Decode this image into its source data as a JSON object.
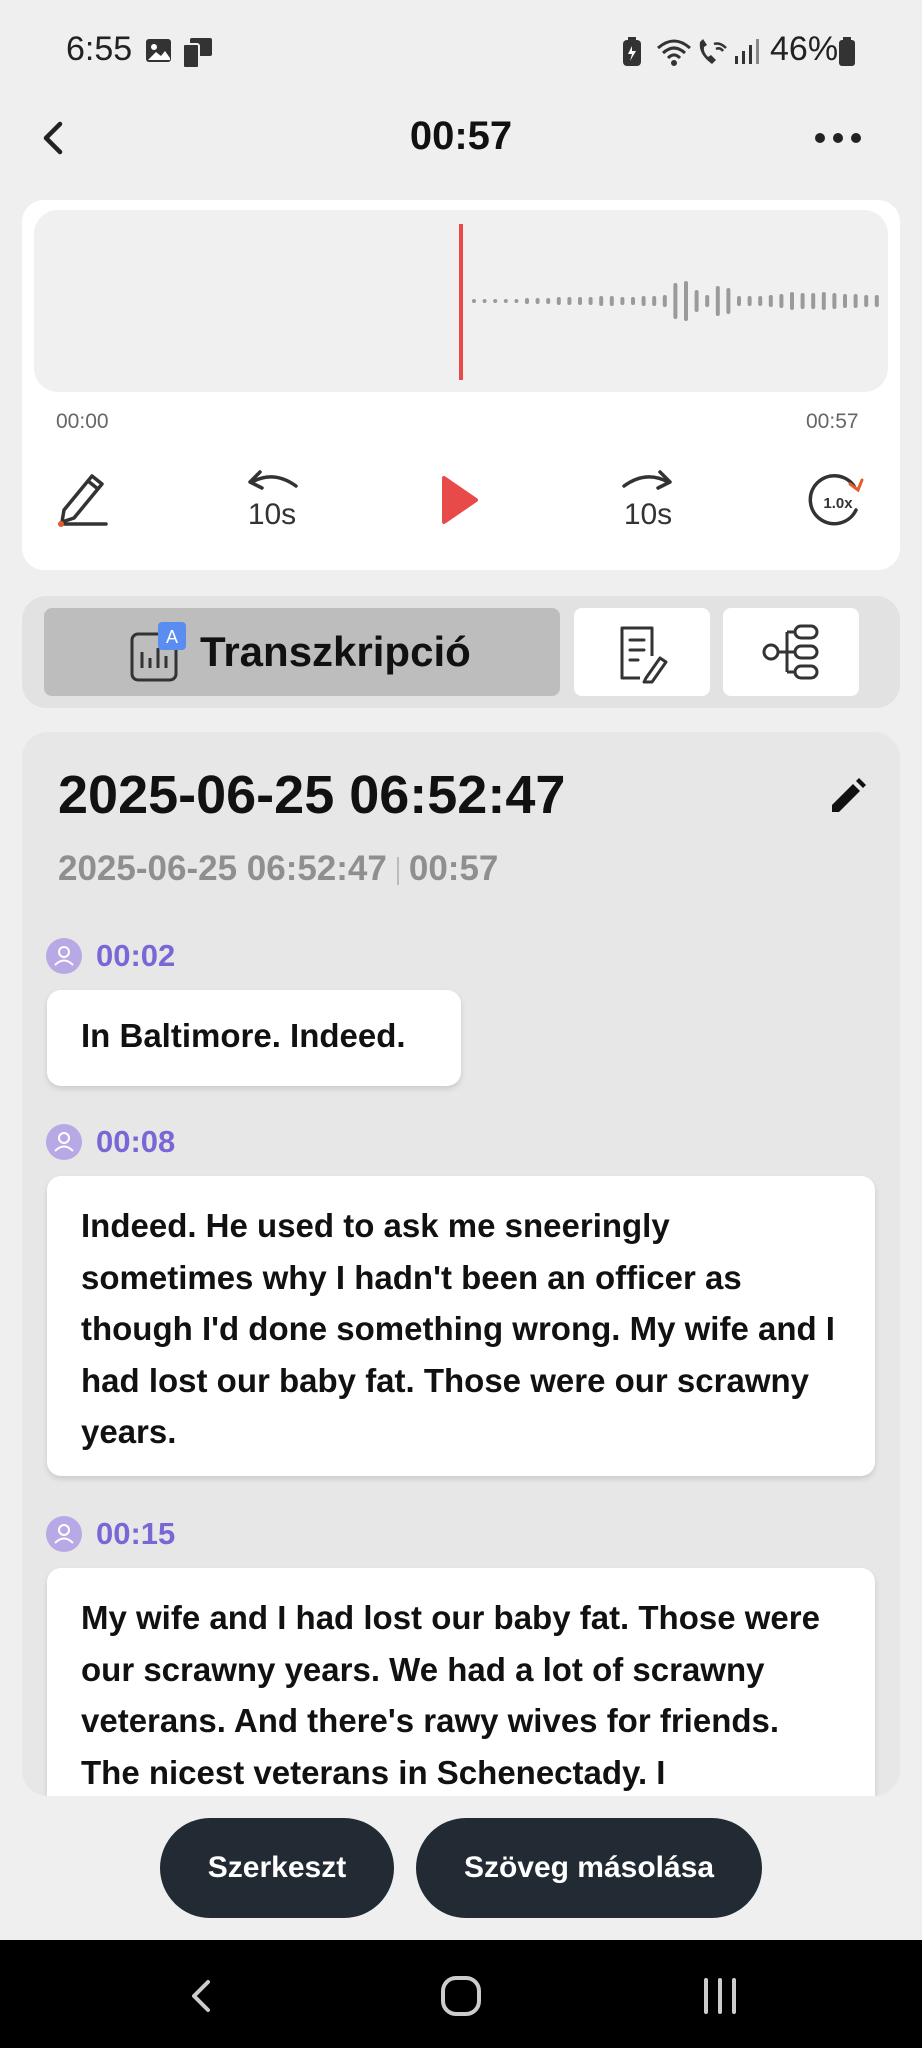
{
  "status_bar": {
    "time": "6:55",
    "battery_percent": "46%",
    "icons": [
      "gallery-icon",
      "cast-icon",
      "battery-saver-icon",
      "wifi-icon",
      "wifi-calling-icon",
      "signal-icon",
      "battery-icon"
    ]
  },
  "header": {
    "title": "00:57",
    "back_icon": "chevron-left-icon",
    "more_icon": "more-horizontal-icon"
  },
  "player": {
    "time_start": "00:00",
    "time_end": "00:57",
    "playhead_color": "#e84a4a",
    "progress": 0,
    "rewind_label": "10s",
    "forward_label": "10s",
    "speed_label": "1.0x",
    "controls": [
      "pen-icon",
      "rewind-10-icon",
      "play-icon",
      "forward-10-icon",
      "speed-icon"
    ]
  },
  "tabs": {
    "transcript_label": "Transzkripció",
    "transcript_badge": "A",
    "notes_icon": "document-edit-icon",
    "mindmap_icon": "mindmap-icon"
  },
  "document": {
    "title": "2025-06-25 06:52:47",
    "meta_date": "2025-06-25 06:52:47",
    "meta_duration": "00:57",
    "segments": [
      {
        "time": "00:02",
        "text": "In Baltimore. Indeed."
      },
      {
        "time": "00:08",
        "text": "Indeed. He used to ask me sneeringly sometimes why I hadn't been an officer as though I'd done something wrong. My wife and I had lost our baby fat. Those were our scrawny years."
      },
      {
        "time": "00:15",
        "text": "My wife and I had lost our baby fat. Those were our scrawny years. We had a lot of scrawny veterans. And there's rawy wives for friends. The nicest veterans in Schenectady. I"
      }
    ]
  },
  "actions": {
    "edit_label": "Szerkeszt",
    "copy_label": "Szöveg másolása"
  },
  "colors": {
    "accent_purple": "#7a66d6",
    "button_dark": "#222a33",
    "play_red": "#e84a4a"
  }
}
